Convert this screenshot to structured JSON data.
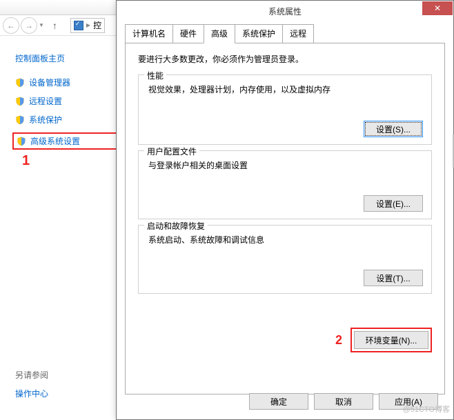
{
  "explorer": {
    "addr_text": "控",
    "sidebar": {
      "title": "控制面板主页",
      "items": [
        {
          "label": "设备管理器"
        },
        {
          "label": "远程设置"
        },
        {
          "label": "系统保护"
        },
        {
          "label": "高级系统设置"
        }
      ]
    },
    "see_also": {
      "title": "另请参阅",
      "items": [
        {
          "label": "操作中心"
        }
      ]
    }
  },
  "dialog": {
    "title": "系统属性",
    "tabs": [
      {
        "label": "计算机名"
      },
      {
        "label": "硬件"
      },
      {
        "label": "高级"
      },
      {
        "label": "系统保护"
      },
      {
        "label": "远程"
      }
    ],
    "admin_notice": "要进行大多数更改，你必须作为管理员登录。",
    "sections": {
      "performance": {
        "legend": "性能",
        "desc": "视觉效果，处理器计划，内存使用，以及虚拟内存",
        "button": "设置(S)..."
      },
      "profiles": {
        "legend": "用户配置文件",
        "desc": "与登录帐户相关的桌面设置",
        "button": "设置(E)..."
      },
      "startup": {
        "legend": "启动和故障恢复",
        "desc": "系统启动、系统故障和调试信息",
        "button": "设置(T)..."
      }
    },
    "env_button": "环境变量(N)...",
    "buttons": {
      "ok": "确定",
      "cancel": "取消",
      "apply": "应用(A)"
    }
  },
  "annotations": {
    "n1": "1",
    "n2": "2"
  },
  "watermark": "@51CTO博客"
}
